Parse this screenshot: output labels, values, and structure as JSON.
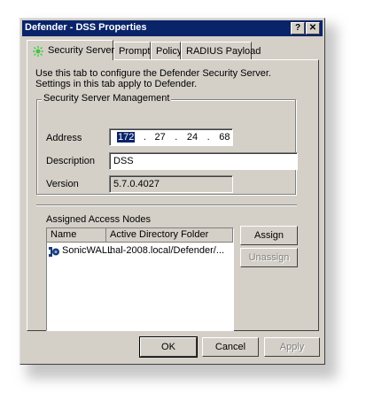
{
  "window": {
    "title": "Defender - DSS Properties",
    "help_glyph": "?",
    "close_glyph": "✕"
  },
  "tabs": [
    {
      "label": "Security Server",
      "active": true
    },
    {
      "label": "Prompts"
    },
    {
      "label": "Policy"
    },
    {
      "label": "RADIUS Payload"
    }
  ],
  "intro": {
    "line1": "Use this tab to configure the Defender Security Server.",
    "line2": "Settings in this tab apply to Defender."
  },
  "management": {
    "group_label": "Security Server Management",
    "address_label": "Address",
    "address": [
      "172",
      "27",
      "24",
      "68"
    ],
    "description_label": "Description",
    "description_value": "DSS",
    "version_label": "Version",
    "version_value": "5.7.0.4027"
  },
  "nodes": {
    "label": "Assigned Access Nodes",
    "columns": [
      "Name",
      "Active Directory Folder"
    ],
    "rows": [
      {
        "name": "SonicWALL",
        "folder": "hal-2008.local/Defender/..."
      }
    ],
    "assign_label": "Assign",
    "unassign_label": "Unassign"
  },
  "footer": {
    "ok_label": "OK",
    "cancel_label": "Cancel",
    "apply_label": "Apply"
  },
  "colors": {
    "title_bar": "#0a246a",
    "face": "#d4d0c8",
    "icon_blue": "#1a3c78",
    "tab_icon": "#3cc83c"
  }
}
